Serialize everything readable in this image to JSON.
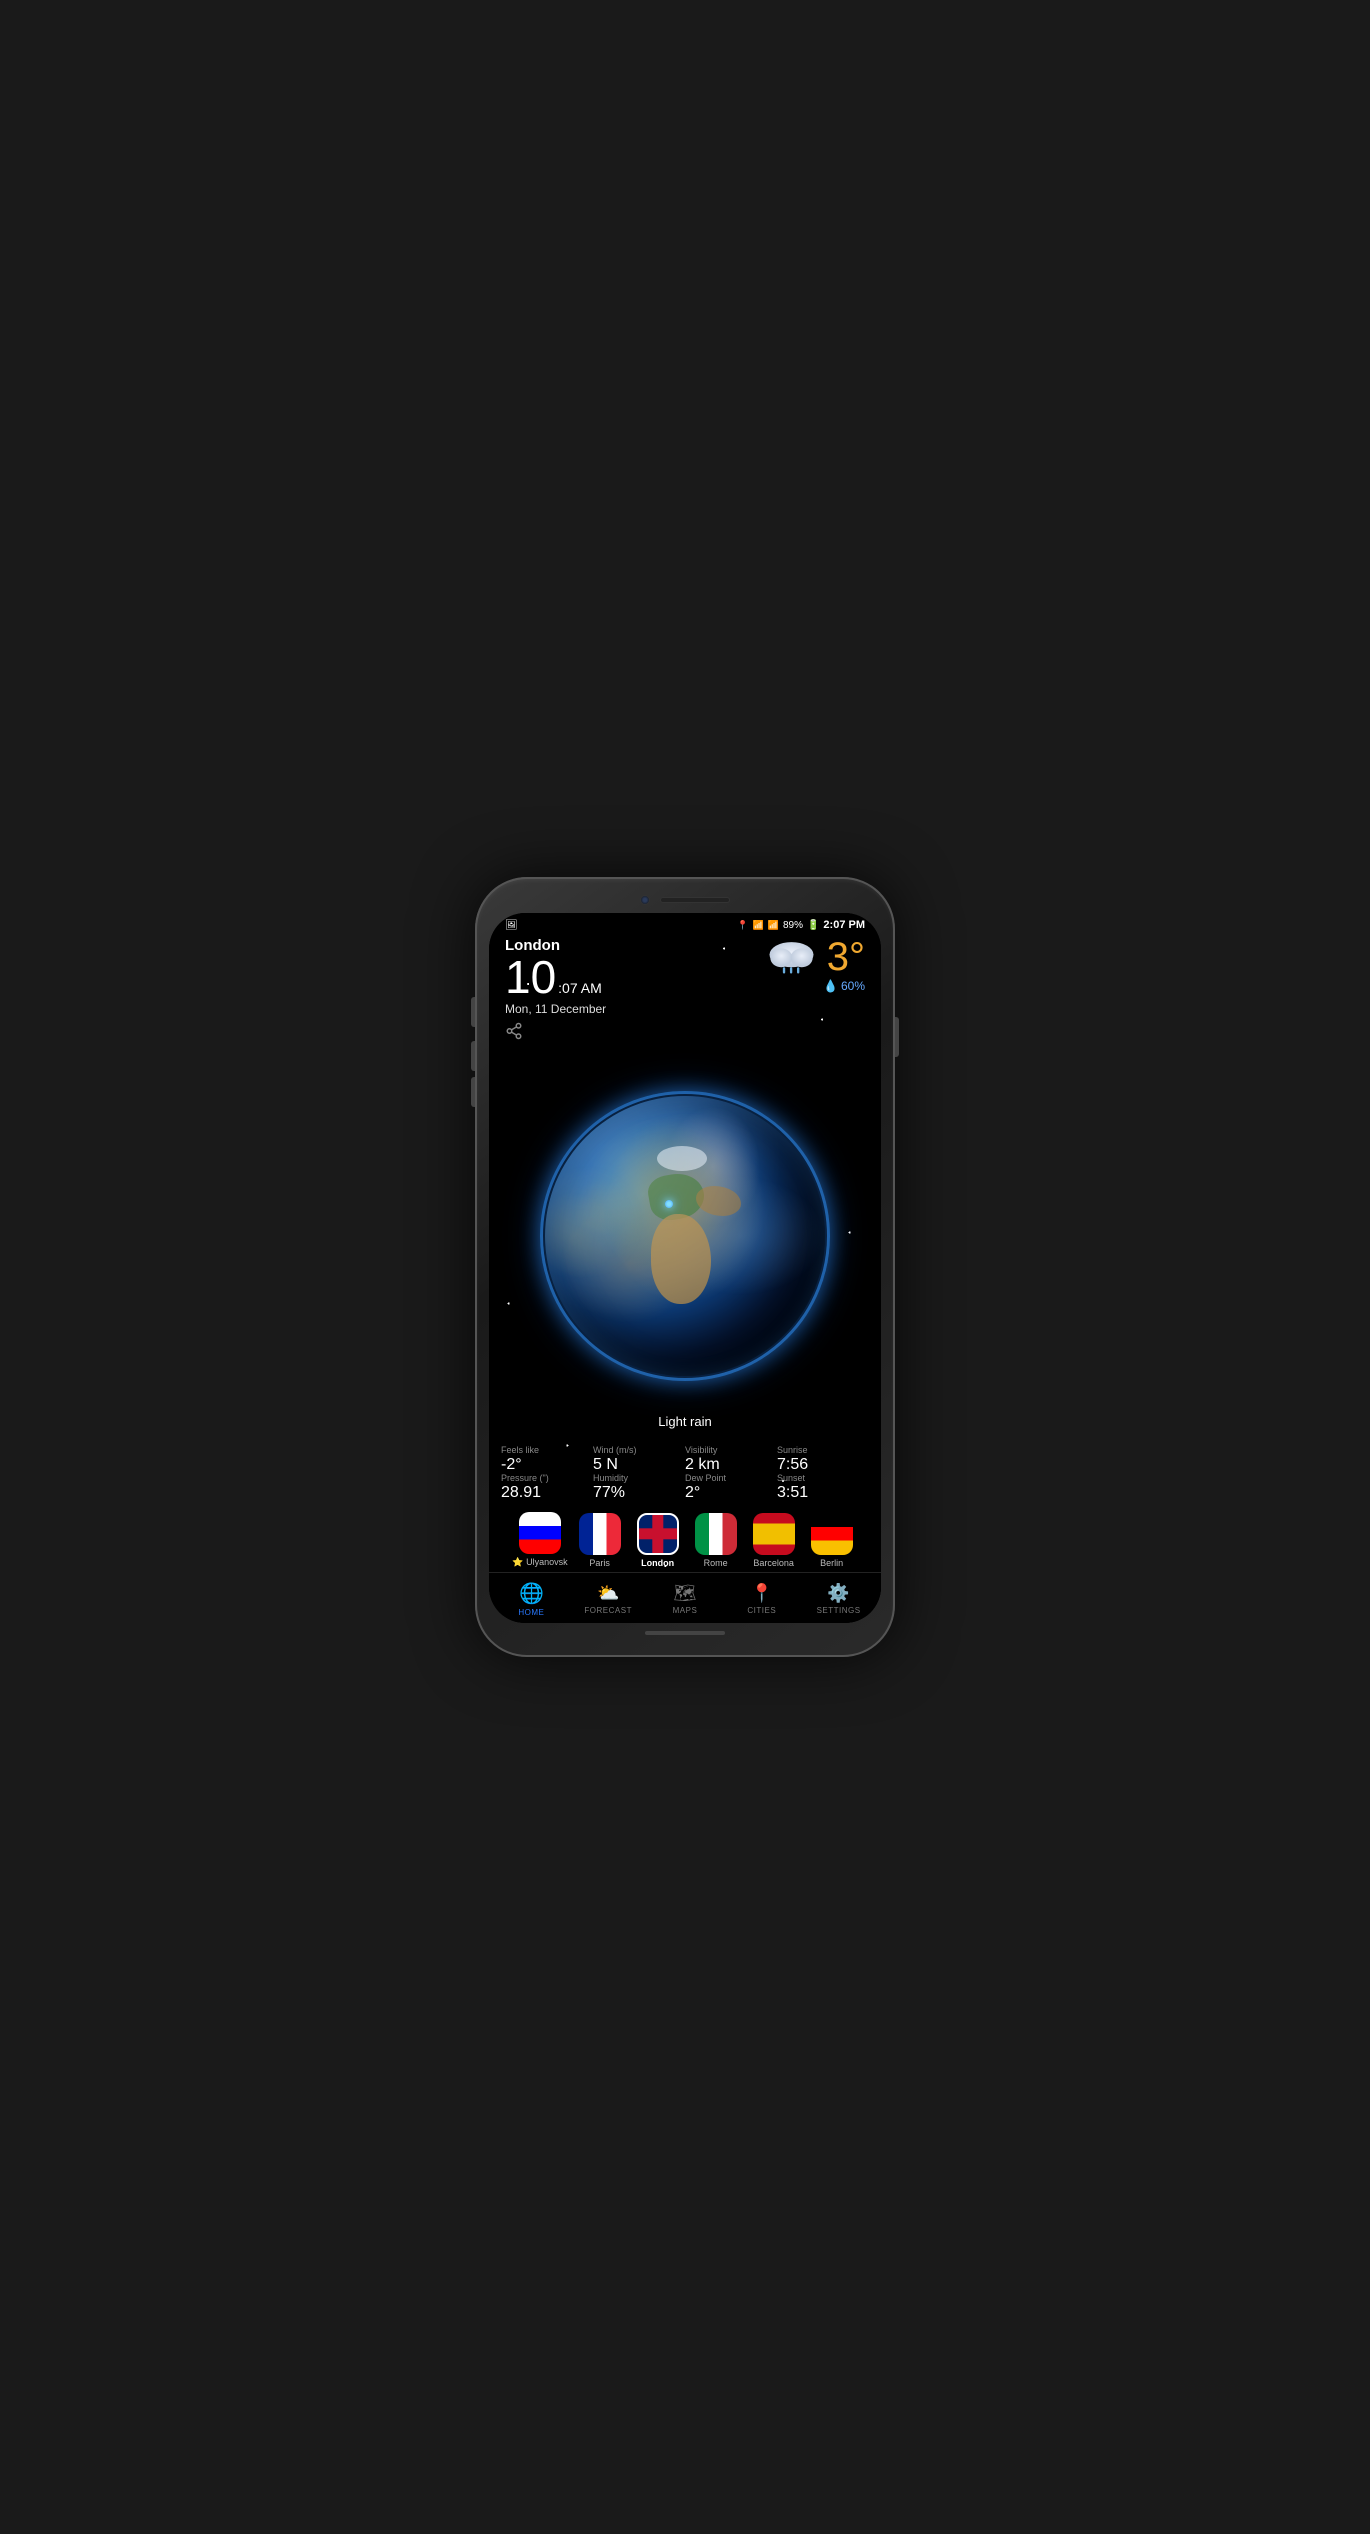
{
  "statusBar": {
    "battery": "89%",
    "time": "2:07 PM",
    "signal": "●●●●",
    "wifi": "WiFi"
  },
  "location": {
    "city": "London",
    "time": "10",
    "timeSmall": ":07 AM",
    "date": "Mon, 11 December"
  },
  "weather": {
    "temp": "3°",
    "condition": "Light rain",
    "precipitation": "60%",
    "feelsLikeLabel": "Feels like",
    "feelsLikeValue": "-2°",
    "windLabel": "Wind (m/s)",
    "windValue": "5 N",
    "visibilityLabel": "Visibility",
    "visibilityValue": "2 km",
    "sunriseLabel": "Sunrise",
    "sunriseValue": "7:56",
    "pressureLabel": "Pressure (\")",
    "pressureValue": "28.91",
    "humidityLabel": "Humidity",
    "humidityValue": "77%",
    "dewPointLabel": "Dew Point",
    "dewPointValue": "2°",
    "sunsetLabel": "Sunset",
    "sunsetValue": "3:51"
  },
  "cities": [
    {
      "name": "Ulyanovsk",
      "flag": "russia",
      "active": false,
      "dot": true
    },
    {
      "name": "Paris",
      "flag": "france",
      "active": false,
      "dot": false
    },
    {
      "name": "London",
      "flag": "uk",
      "active": true,
      "dot": false
    },
    {
      "name": "Rome",
      "flag": "italy",
      "active": false,
      "dot": false
    },
    {
      "name": "Barcelona",
      "flag": "spain",
      "active": false,
      "dot": false
    },
    {
      "name": "Berlin",
      "flag": "berlin",
      "active": false,
      "dot": false
    }
  ],
  "nav": {
    "items": [
      {
        "id": "home",
        "label": "HOME",
        "active": true
      },
      {
        "id": "forecast",
        "label": "FORECAST",
        "active": false
      },
      {
        "id": "maps",
        "label": "MAPS",
        "active": false
      },
      {
        "id": "cities",
        "label": "CITIES",
        "active": false
      },
      {
        "id": "settings",
        "label": "SETTINGS",
        "active": false
      }
    ]
  }
}
